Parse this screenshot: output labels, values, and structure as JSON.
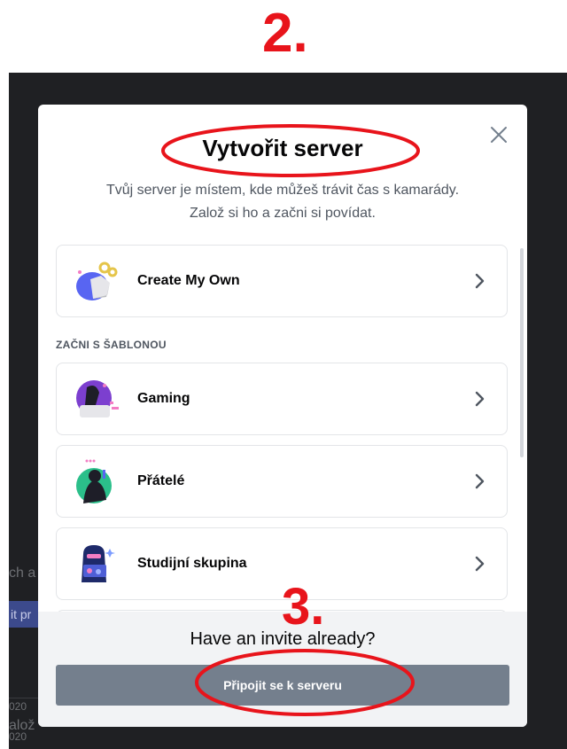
{
  "annotations": {
    "step_top": "2.",
    "step_bottom": "3.",
    "color": "#e8141b"
  },
  "background": {
    "fragments": [
      "ch a",
      "it pr",
      "020",
      "alož",
      "020"
    ]
  },
  "modal": {
    "title": "Vytvořit server",
    "subtitle_line1": "Tvůj server je místem, kde můžeš trávit čas s kamarády.",
    "subtitle_line2": "Založ si ho a začni si povídat.",
    "close_icon": "close-icon",
    "create_option": {
      "label": "Create My Own",
      "icon": "create-own-icon"
    },
    "template_header": "ZAČNI S ŠABLONOU",
    "templates": [
      {
        "label": "Gaming",
        "icon": "gaming-icon"
      },
      {
        "label": "Přátelé",
        "icon": "friends-icon"
      },
      {
        "label": "Studijní skupina",
        "icon": "study-group-icon"
      }
    ],
    "footer": {
      "title": "Have an invite already?",
      "join_button": "Připojit se k serveru"
    }
  },
  "colors": {
    "join_button": "#747f8d",
    "backdrop": "#1f2023",
    "annotation": "#e8141b"
  }
}
